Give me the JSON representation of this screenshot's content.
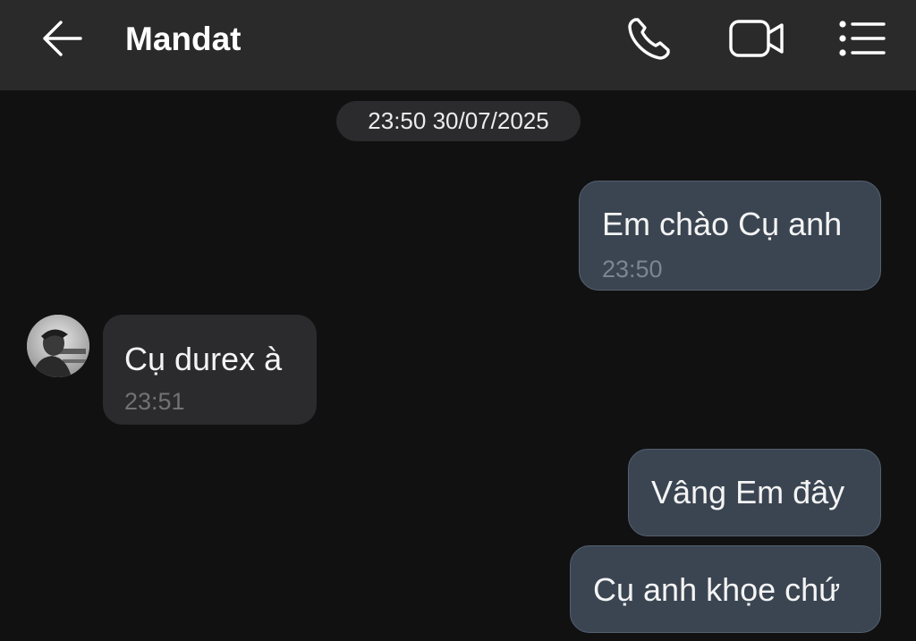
{
  "header": {
    "title": "Mandat",
    "back_icon": "arrow-left-icon",
    "call_icon": "phone-icon",
    "video_icon": "video-camera-icon",
    "menu_icon": "list-menu-icon"
  },
  "conversation": {
    "date_separator": "23:50 30/07/2025",
    "messages": [
      {
        "direction": "outgoing",
        "text": "Em chào Cụ anh",
        "time": "23:50"
      },
      {
        "direction": "incoming",
        "text": "Cụ durex à",
        "time": "23:51",
        "avatar": "contact-avatar"
      },
      {
        "direction": "outgoing",
        "text": "Vâng Em đây"
      },
      {
        "direction": "outgoing",
        "text": "Cụ anh khọe chứ"
      }
    ]
  },
  "colors": {
    "background": "#111112",
    "header": "#2a2a2b",
    "outgoing_bubble": "#3b4552",
    "incoming_bubble": "#2b2b2d"
  }
}
